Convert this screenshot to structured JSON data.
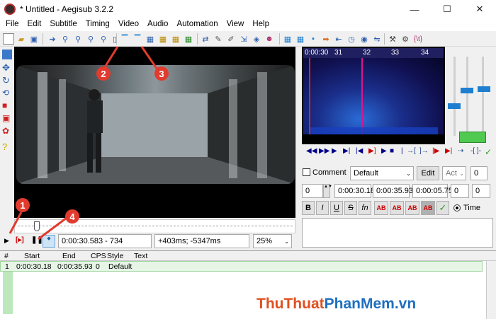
{
  "window": {
    "title": "* Untitled - Aegisub 3.2.2",
    "minimize": "—",
    "maximize": "☐",
    "close": "✕"
  },
  "menu": {
    "items": [
      "File",
      "Edit",
      "Subtitle",
      "Timing",
      "Video",
      "Audio",
      "Automation",
      "View",
      "Help"
    ]
  },
  "audio": {
    "ruler_labels": [
      "0:00:30",
      "31",
      "32",
      "33",
      "34"
    ]
  },
  "video_controls": {
    "time_display": "0:00:30.583 - 734",
    "offset_display": "+403ms; -5347ms",
    "zoom": "25%"
  },
  "edit": {
    "comment_label": "Comment",
    "style_value": "Default",
    "edit_button": "Edit",
    "actor_placeholder": "Act",
    "effect_value": "0",
    "layer_value": "0",
    "start_time": "0:00:30.18",
    "end_time": "0:00:35.93",
    "duration": "0:00:05.75",
    "margin_l": "0",
    "margin_r": "0",
    "format_bold": "B",
    "format_italic": "I",
    "format_underline": "U",
    "format_strike": "S",
    "format_fn": "fn",
    "color_labels": [
      "AB",
      "AB",
      "AB",
      "AB"
    ],
    "time_label": "Time"
  },
  "grid": {
    "headers": [
      "#",
      "Start",
      "End",
      "CPS",
      "Style",
      "Text"
    ],
    "rows": [
      {
        "num": "1",
        "start": "0:00:30.18",
        "end": "0:00:35.93",
        "cps": "0",
        "style": "Default",
        "text": ""
      }
    ]
  },
  "annotations": {
    "marks": [
      "1",
      "2",
      "3",
      "4"
    ]
  },
  "watermark": {
    "part1": "Thu",
    "part2": "Thuat",
    "part3": "Phan",
    "part4": "Mem",
    "part5": ".vn"
  },
  "colors": {
    "annotation_red": "#e23b2e",
    "grid_row_green": "#e6f5e6",
    "audio_bg": "#101050",
    "selection_line": "#e0138c",
    "confirm_green": "#2a9d2a"
  }
}
